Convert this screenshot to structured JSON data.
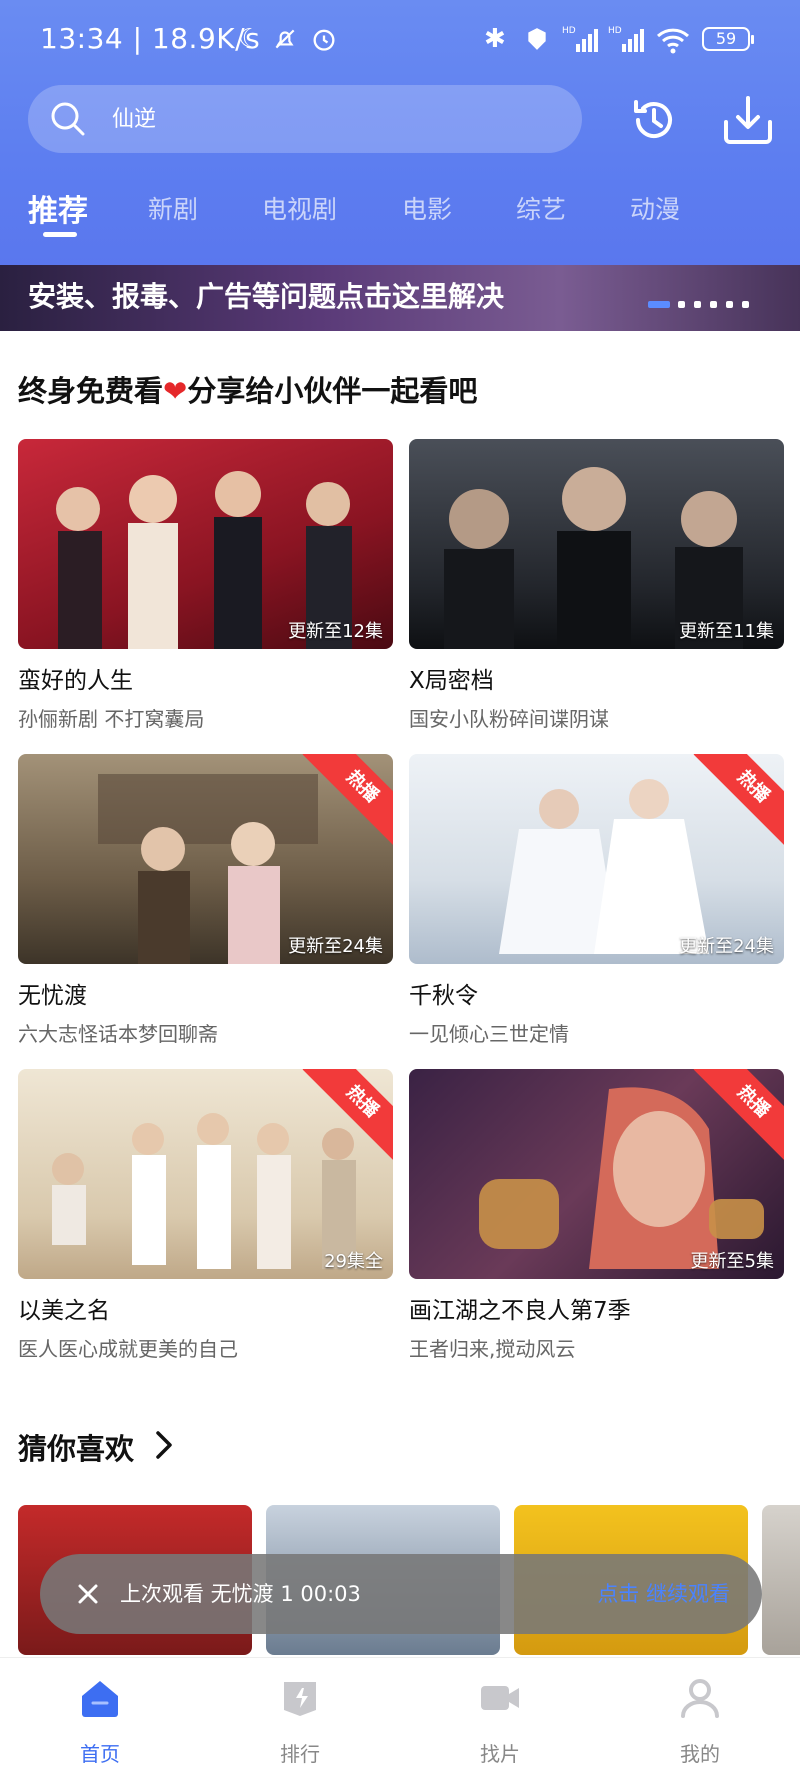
{
  "status_bar": {
    "time": "13:34 | 18.9K/s",
    "battery": "59"
  },
  "search": {
    "placeholder": "仙逆"
  },
  "header_icons": [
    "history-icon",
    "download-icon"
  ],
  "tabs": [
    {
      "label": "推荐",
      "active": true
    },
    {
      "label": "新剧"
    },
    {
      "label": "电视剧"
    },
    {
      "label": "电影"
    },
    {
      "label": "综艺"
    },
    {
      "label": "动漫"
    }
  ],
  "banner": {
    "text": "安装、报毒、广告等问题点击这里解决"
  },
  "featured": {
    "title_before": "终身免费看",
    "title_after": "分享给小伙伴一起看吧",
    "items": [
      {
        "title": "蛮好的人生",
        "subtitle": "孙俪新剧 不打窝囊局",
        "badge": "更新至12集",
        "ribbon": "",
        "colors": [
          "#b81f2c",
          "#5a0f18"
        ]
      },
      {
        "title": "X局密档",
        "subtitle": "国安小队粉碎间谍阴谋",
        "badge": "更新至11集",
        "ribbon": "",
        "colors": [
          "#3a3f48",
          "#14171c"
        ]
      },
      {
        "title": "无忧渡",
        "subtitle": "六大志怪话本梦回聊斋",
        "badge": "更新至24集",
        "ribbon": "热播",
        "colors": [
          "#8a7a62",
          "#3d3428"
        ]
      },
      {
        "title": "千秋令",
        "subtitle": "一见倾心三世定情",
        "badge": "更新至24集",
        "ribbon": "热播",
        "colors": [
          "#e6ecf2",
          "#b9c6d2"
        ]
      },
      {
        "title": "以美之名",
        "subtitle": "医人医心成就更美的自己",
        "badge": "29集全",
        "ribbon": "热播",
        "colors": [
          "#e7dcc8",
          "#c9b89c"
        ]
      },
      {
        "title": "画江湖之不良人第7季",
        "subtitle": "王者归来,搅动风云",
        "badge": "更新至5集",
        "ribbon": "热播",
        "colors": [
          "#4a2a4a",
          "#1c1020"
        ]
      }
    ]
  },
  "guess": {
    "title": "猜你喜欢"
  },
  "toast": {
    "text": "上次观看 无忧渡 1 00:03",
    "action": "点击 继续观看"
  },
  "bottom_nav": [
    {
      "label": "首页",
      "icon": "home-icon",
      "active": true
    },
    {
      "label": "排行",
      "icon": "ranking-icon"
    },
    {
      "label": "找片",
      "icon": "video-icon"
    },
    {
      "label": "我的",
      "icon": "profile-icon"
    }
  ]
}
